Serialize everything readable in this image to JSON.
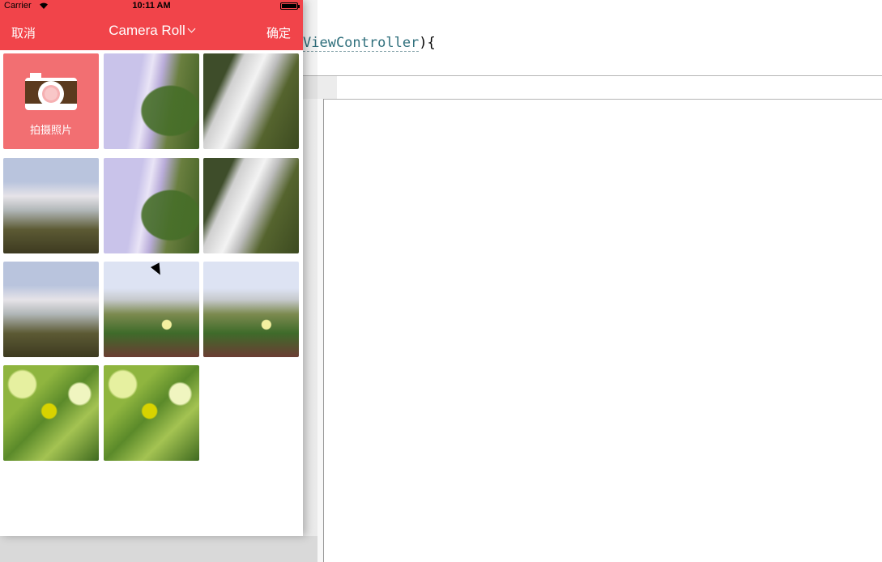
{
  "status_bar": {
    "carrier": "Carrier",
    "time": "10:11 AM"
  },
  "nav": {
    "cancel_label": "取消",
    "title": "Camera Roll",
    "confirm_label": "确定"
  },
  "camera_tile": {
    "label": "拍摄照片",
    "icon": "camera-icon"
  },
  "photos": [
    {
      "scene": "waterfall-a"
    },
    {
      "scene": "waterfall-b"
    },
    {
      "scene": "waterfall-c"
    },
    {
      "scene": "waterfall-a"
    },
    {
      "scene": "waterfall-b"
    },
    {
      "scene": "waterfall-c"
    },
    {
      "scene": "meadow"
    },
    {
      "scene": "meadow"
    },
    {
      "scene": "leaves"
    },
    {
      "scene": "leaves"
    }
  ],
  "editor": {
    "code_type": "ViewController",
    "code_suffix": "){"
  },
  "colors": {
    "nav_background": "#f1444a",
    "camera_tile_background": "#f26f72"
  }
}
